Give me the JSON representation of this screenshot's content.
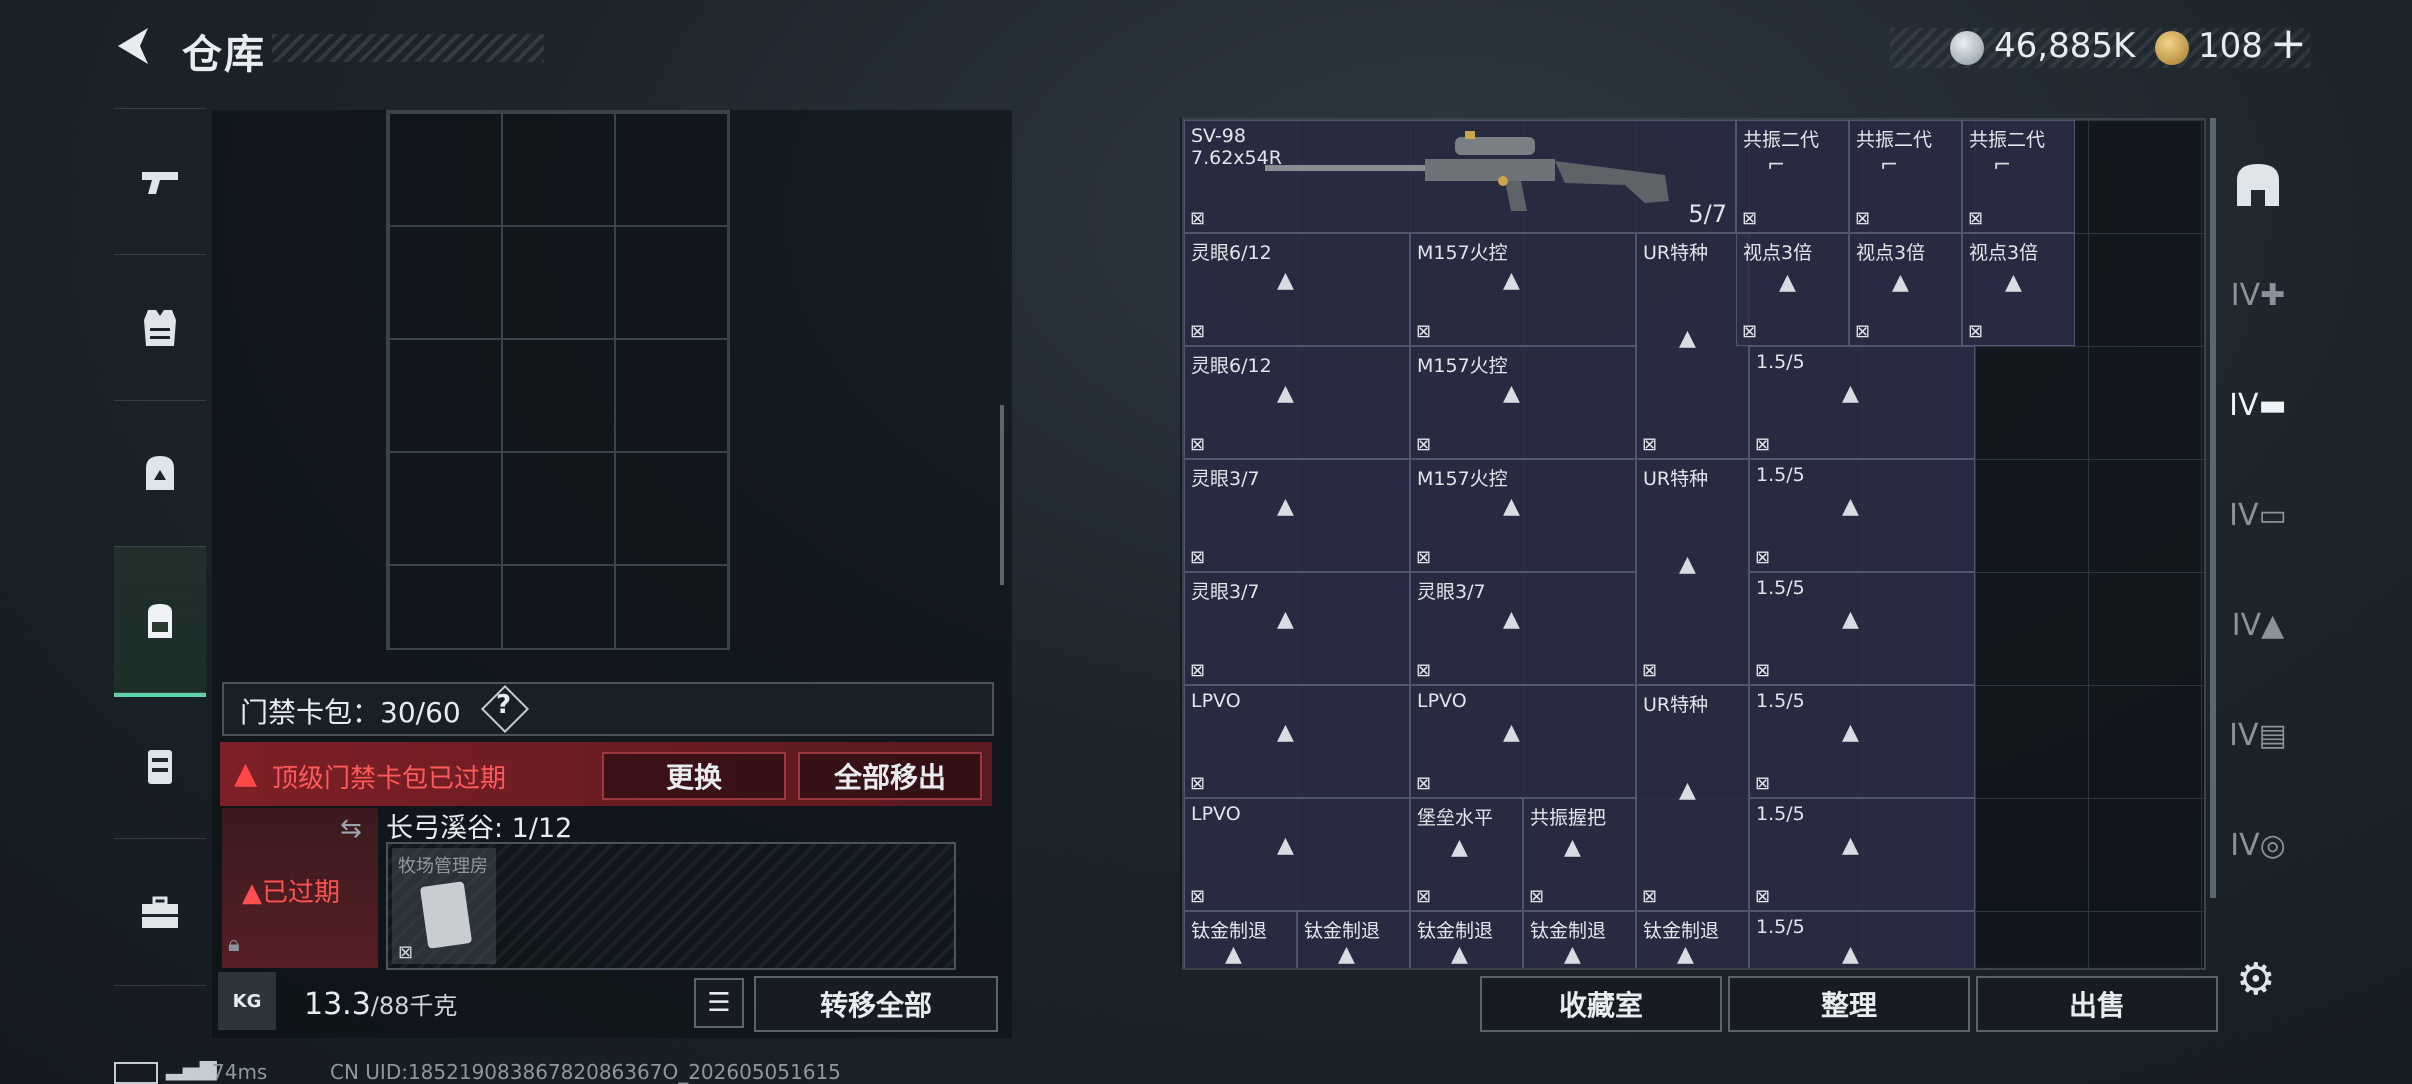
{
  "header": {
    "title": "仓库",
    "currency": [
      {
        "icon": "silver-coin-icon",
        "value": "46,885K"
      },
      {
        "icon": "gold-coin-icon",
        "value": "108"
      }
    ],
    "plus_label": "+"
  },
  "left_nav": [
    {
      "icon": "pistol-icon"
    },
    {
      "icon": "vest-icon"
    },
    {
      "icon": "helmet-icon"
    },
    {
      "icon": "backpack-icon",
      "active": true
    },
    {
      "icon": "chest-rig-icon"
    },
    {
      "icon": "toolbox-icon"
    }
  ],
  "card_pack": {
    "label": "门禁卡包：30/60",
    "help": "?"
  },
  "warning": {
    "icon": "▲",
    "text": "顶级门禁卡包已过期",
    "replace_label": "更换",
    "remove_all_label": "全部移出"
  },
  "expired_card": {
    "label": "▲已过期"
  },
  "area": {
    "label": "长弓溪谷: 1/12",
    "room_name": "牧场管理房"
  },
  "bottom_left": {
    "weight_icon": "KG",
    "weight_current": "13.3",
    "weight_max": "/88千克",
    "transfer_all_label": "转移全部"
  },
  "status": {
    "ping": "74ms",
    "uid": "CN UID:18521908386782086367O_202605051615"
  },
  "weapon": {
    "name": "SV-98",
    "ammo": "7.62x54R",
    "count": "5/7"
  },
  "inventory_labels": {
    "resonance": "共振二代",
    "lingyan612": "灵眼6/12",
    "lingyan37": "灵眼3/7",
    "m157": "M157火控",
    "ur": "UR特种",
    "sight3x": "视点3倍",
    "scope15": "1.5/5",
    "lpvo": "LPVO",
    "fortress": "堡垒水平",
    "grip": "共振握把",
    "titanium": "钛金制退"
  },
  "bottom_right": {
    "collection_label": "收藏室",
    "sort_label": "整理",
    "sell_label": "出售"
  },
  "colors": {
    "accent_green": "#5fd2a7",
    "warning_red": "#ff5a5a",
    "item_bg": "#2b2e46"
  }
}
